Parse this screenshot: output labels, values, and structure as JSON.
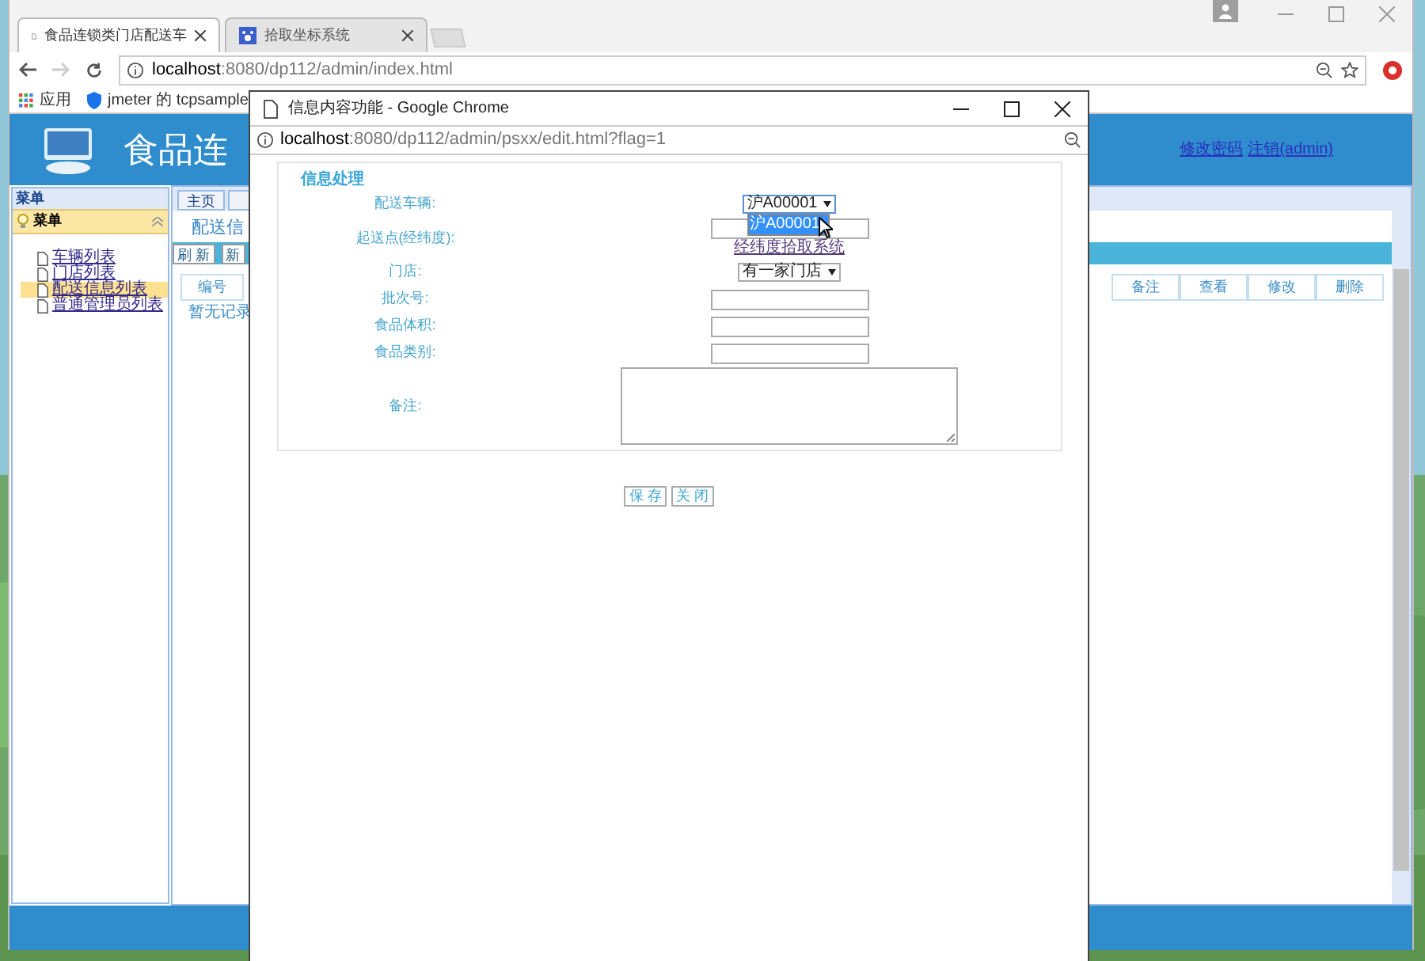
{
  "browser": {
    "tabs": [
      {
        "title": "食品连锁类门店配送车",
        "selected": true
      },
      {
        "title": "拾取坐标系统",
        "selected": false
      }
    ],
    "address": {
      "host": "localhost",
      "path": ":8080/dp112/admin/index.html"
    },
    "bookmarks": [
      "应用",
      "jmeter 的 tcpsample"
    ]
  },
  "page": {
    "title": "食品连",
    "header_links": [
      "修改密码",
      "注销(admin)"
    ],
    "sidebar": {
      "header": "菜单",
      "group": {
        "title": "菜单",
        "expanded": true,
        "items": [
          {
            "label": "车辆列表",
            "selected": false
          },
          {
            "label": "门店列表",
            "selected": false
          },
          {
            "label": "配送信息列表",
            "selected": true
          },
          {
            "label": "普通管理员列表",
            "selected": false
          }
        ]
      }
    },
    "tabs": [
      "主页"
    ],
    "section_title": "配送信",
    "toolbar": [
      "刷 新",
      "新"
    ],
    "table": {
      "columns": [
        "编号",
        "备注",
        "查看",
        "修改",
        "删除"
      ],
      "empty": "暂无记录"
    }
  },
  "popup": {
    "title": "信息内容功能 - Google Chrome",
    "address": {
      "host": "localhost",
      "path": ":8080/dp112/admin/psxx/edit.html?flag=1"
    },
    "legend": "信息处理",
    "fields": [
      {
        "kind": "select",
        "label": "配送车辆:",
        "value": "沪A00001",
        "expanded": true,
        "options": [
          {
            "label": "沪A00001",
            "selected": true
          }
        ]
      },
      {
        "kind": "input",
        "label": "起送点(经纬度):",
        "link": "经纬度拾取系统"
      },
      {
        "kind": "select",
        "label": "门店:",
        "value": "有一家门店",
        "expanded": false
      },
      {
        "kind": "input",
        "label": "批次号:"
      },
      {
        "kind": "input",
        "label": "食品体积:"
      },
      {
        "kind": "input",
        "label": "食品类别:"
      },
      {
        "kind": "textarea",
        "label": "备注:"
      }
    ],
    "buttons": [
      "保 存",
      "关 闭"
    ]
  }
}
